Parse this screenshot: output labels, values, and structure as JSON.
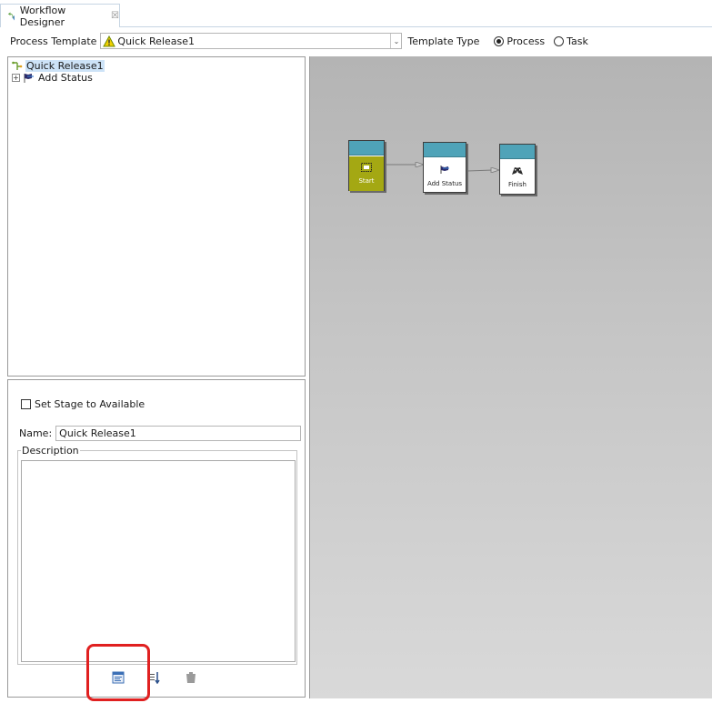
{
  "tab": {
    "title": "Workflow Designer",
    "close": "☒"
  },
  "toolbar": {
    "process_template_label": "Process Template",
    "process_template_value": "Quick Release1",
    "template_type_label": "Template Type",
    "radio_process": "Process",
    "radio_task": "Task",
    "selected_type": "Process"
  },
  "tree": {
    "root": "Quick Release1",
    "children": [
      {
        "label": "Add Status",
        "expander": "+"
      }
    ]
  },
  "properties": {
    "stage_available_label": "Set Stage to Available",
    "stage_available_checked": false,
    "name_label": "Name:",
    "name_value": "Quick Release1",
    "description_label": "Description",
    "description_value": ""
  },
  "bottom_buttons": [
    {
      "icon": "edit-properties-icon"
    },
    {
      "icon": "sort-icon"
    },
    {
      "icon": "delete-icon"
    }
  ],
  "workflow": {
    "nodes": [
      {
        "label": "Start"
      },
      {
        "label": "Add Status"
      },
      {
        "label": "Finish"
      }
    ]
  },
  "colors": {
    "node_header": "#4fa3b8",
    "start_body": "#a4a813",
    "highlight": "#e02020",
    "tree_selection": "#cde3f7"
  }
}
